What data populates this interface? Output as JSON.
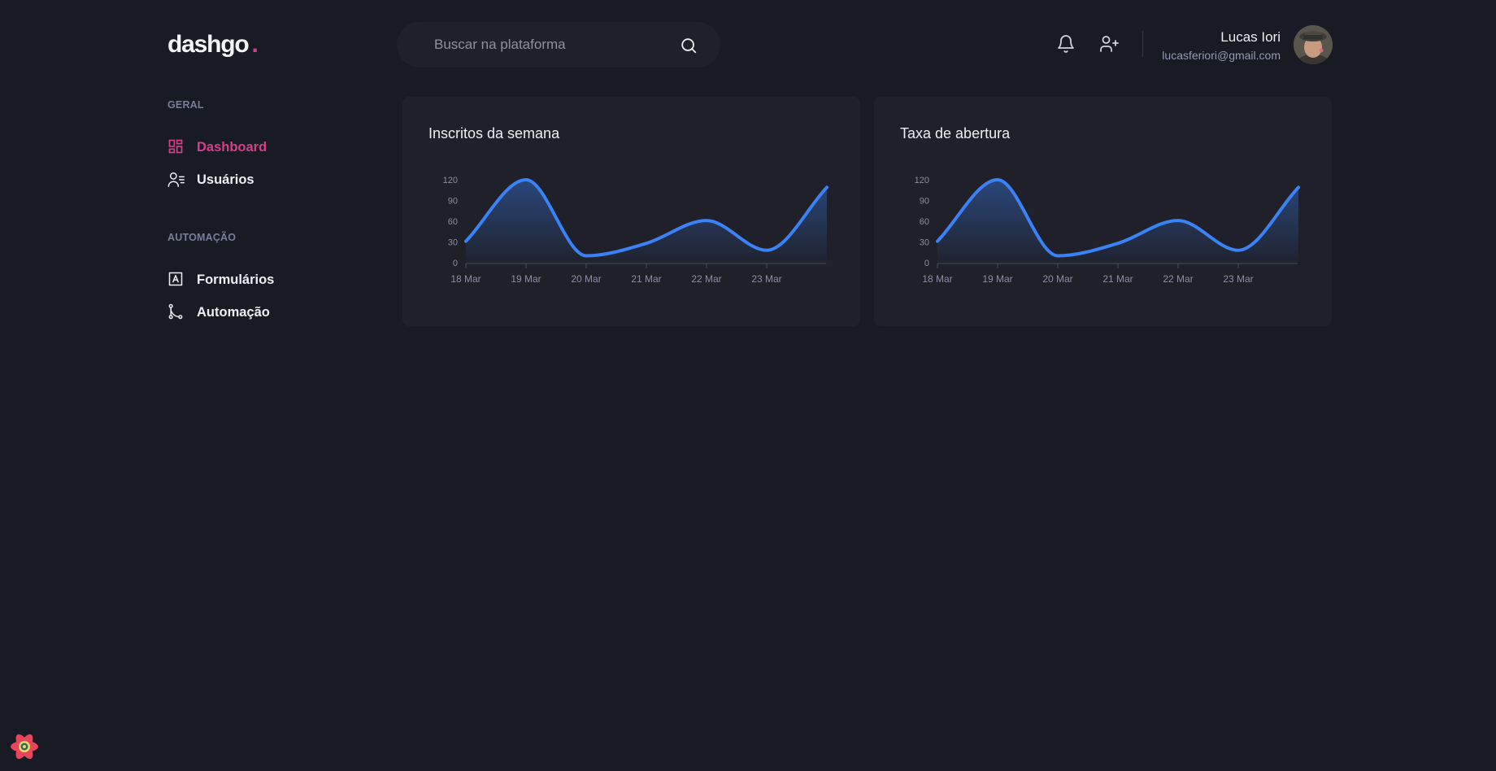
{
  "brand": {
    "name": "dashgo",
    "dot": ".",
    "accent": "#d53f8c"
  },
  "search": {
    "placeholder": "Buscar na plataforma",
    "value": ""
  },
  "header": {
    "icons": [
      "bell-icon",
      "user-plus-icon"
    ],
    "profile": {
      "name": "Lucas Iori",
      "email": "lucasferiori@gmail.com"
    }
  },
  "sidebar": {
    "sections": [
      {
        "title": "GERAL",
        "items": [
          {
            "label": "Dashboard",
            "icon": "dashboard-icon",
            "active": true
          },
          {
            "label": "Usuários",
            "icon": "users-icon",
            "active": false
          }
        ]
      },
      {
        "title": "AUTOMAÇÃO",
        "items": [
          {
            "label": "Formulários",
            "icon": "form-icon",
            "active": false
          },
          {
            "label": "Automação",
            "icon": "git-merge-icon",
            "active": false
          }
        ]
      }
    ]
  },
  "cards": [
    {
      "title": "Inscritos da semana"
    },
    {
      "title": "Taxa de abertura"
    }
  ],
  "chart_data": [
    {
      "type": "area",
      "title": "Inscritos da semana",
      "x": [
        "2021-03-18",
        "2021-03-19",
        "2021-03-20",
        "2021-03-21",
        "2021-03-22",
        "2021-03-23",
        "2021-03-24"
      ],
      "x_tick_labels": [
        "18 Mar",
        "19 Mar",
        "20 Mar",
        "21 Mar",
        "22 Mar",
        "23 Mar"
      ],
      "y_ticks": [
        0,
        30,
        60,
        90,
        120
      ],
      "series": [
        {
          "values": [
            31,
            120,
            10,
            28,
            61,
            18,
            109
          ]
        }
      ],
      "ylim": [
        0,
        120
      ],
      "grid": false,
      "colors": {
        "line": "#3b82f6",
        "fill": "#3b82f6"
      }
    },
    {
      "type": "area",
      "title": "Taxa de abertura",
      "x": [
        "2021-03-18",
        "2021-03-19",
        "2021-03-20",
        "2021-03-21",
        "2021-03-22",
        "2021-03-23",
        "2021-03-24"
      ],
      "x_tick_labels": [
        "18 Mar",
        "19 Mar",
        "20 Mar",
        "21 Mar",
        "22 Mar",
        "23 Mar"
      ],
      "y_ticks": [
        0,
        30,
        60,
        90,
        120
      ],
      "series": [
        {
          "values": [
            31,
            120,
            10,
            28,
            61,
            18,
            109
          ]
        }
      ],
      "ylim": [
        0,
        120
      ],
      "grid": false,
      "colors": {
        "line": "#3b82f6",
        "fill": "#3b82f6"
      }
    }
  ],
  "colors": {
    "background": "#181b23",
    "surface": "#1f2029",
    "muted_text": "#797d9a",
    "text": "#eeeef2"
  }
}
